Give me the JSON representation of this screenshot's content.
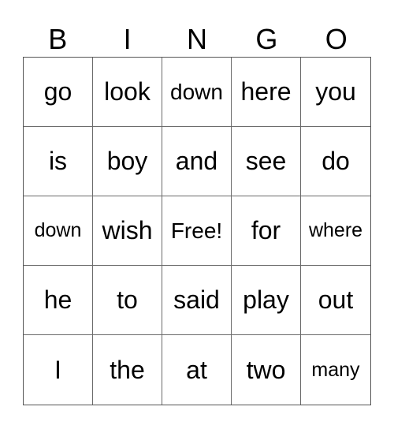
{
  "header": [
    "B",
    "I",
    "N",
    "G",
    "O"
  ],
  "cells": [
    [
      "go",
      "look",
      "down",
      "here",
      "you"
    ],
    [
      "is",
      "boy",
      "and",
      "see",
      "do"
    ],
    [
      "down",
      "wish",
      "Free!",
      "for",
      "where"
    ],
    [
      "he",
      "to",
      "said",
      "play",
      "out"
    ],
    [
      "I",
      "the",
      "at",
      "two",
      "many"
    ]
  ]
}
